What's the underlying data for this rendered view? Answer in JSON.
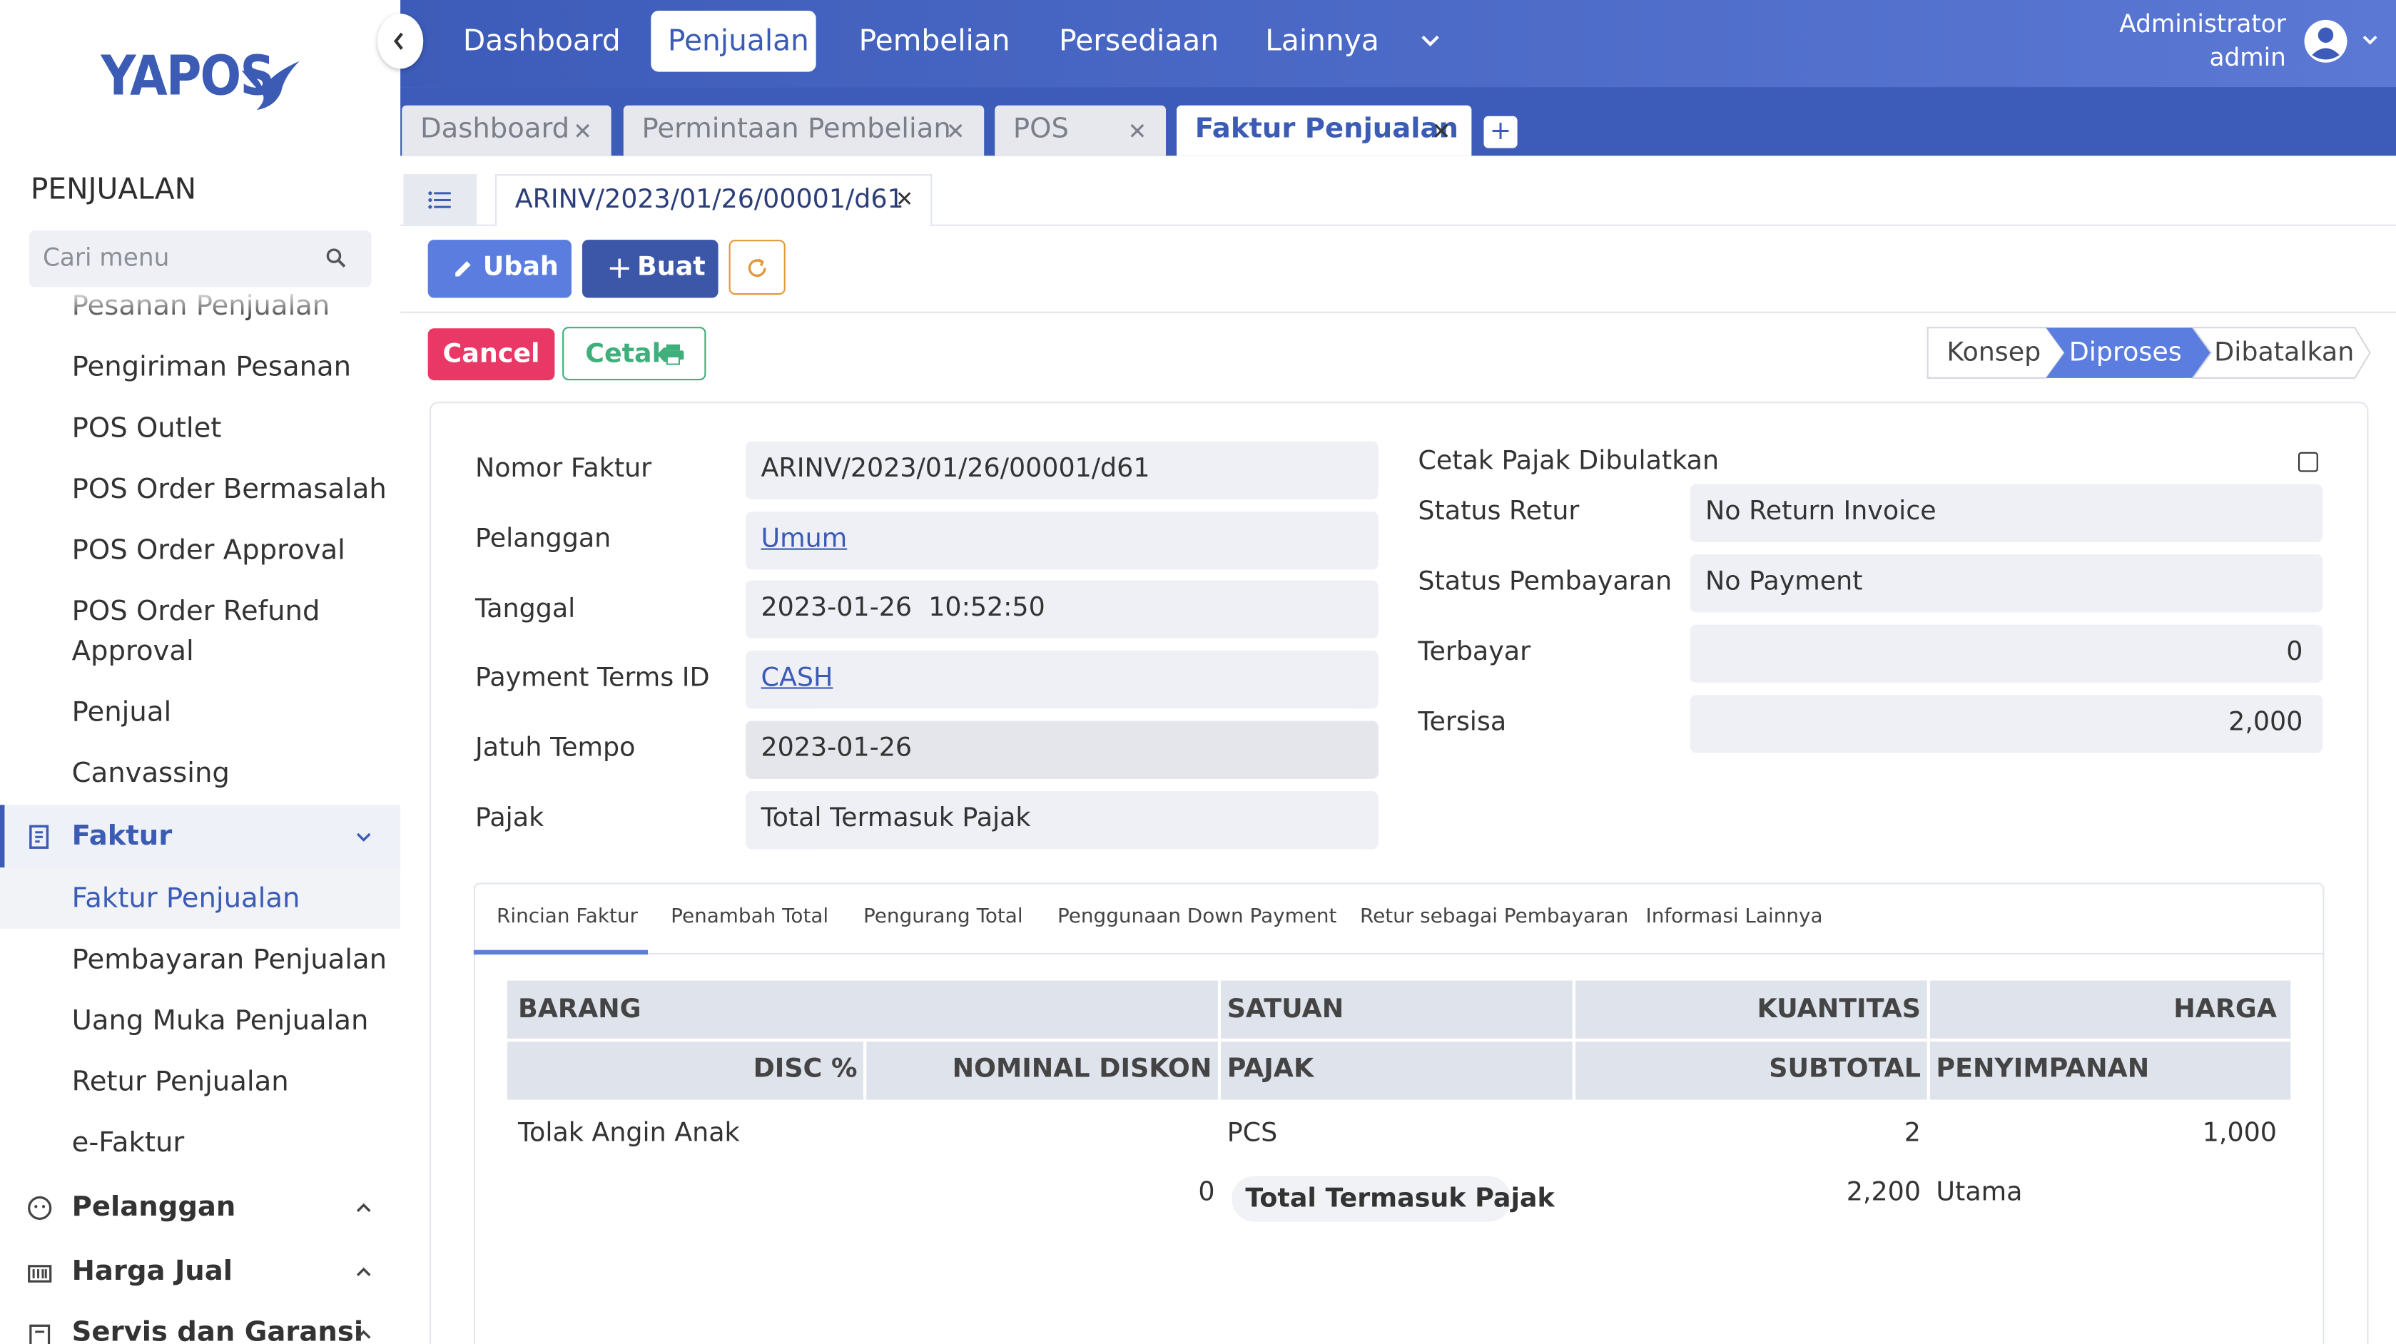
{
  "brand": {
    "logo_text": "YAPOS"
  },
  "sidebar": {
    "section_title": "PENJUALAN",
    "search_placeholder": "Cari menu",
    "items": [
      {
        "label": "Pesanan Penjualan"
      },
      {
        "label": "Pengiriman Pesanan"
      },
      {
        "label": "POS Outlet"
      },
      {
        "label": "POS Order Bermasalah"
      },
      {
        "label": "POS Order Approval"
      },
      {
        "label": "POS Order Refund"
      },
      {
        "label": "Approval"
      },
      {
        "label": "Penjual"
      },
      {
        "label": "Canvassing"
      }
    ],
    "faktur_group": {
      "label": "Faktur",
      "children": [
        "Faktur Penjualan",
        "Pembayaran Penjualan",
        "Uang Muka Penjualan",
        "Retur Penjualan",
        "e-Faktur"
      ]
    },
    "groups": [
      {
        "label": "Pelanggan"
      },
      {
        "label": "Harga Jual"
      },
      {
        "label": "Servis dan Garansi"
      }
    ]
  },
  "topnav": {
    "items": [
      "Dashboard",
      "Penjualan",
      "Pembelian",
      "Persediaan",
      "Lainnya"
    ],
    "active": "Penjualan",
    "user_name": "Administrator",
    "user_role": "admin"
  },
  "tabs": [
    {
      "label": "Dashboard"
    },
    {
      "label": "Permintaan Pembelian"
    },
    {
      "label": "POS"
    },
    {
      "label": "Faktur Penjualan",
      "active": true
    }
  ],
  "tab_plus": "+",
  "doc_tab": {
    "label": "ARINV/2023/01/26/00001/d61"
  },
  "actions": {
    "ubah": "Ubah",
    "buat": "Buat",
    "cancel": "Cancel",
    "cetak": "Cetak"
  },
  "status_steps": [
    "Konsep",
    "Diproses",
    "Dibatalkan"
  ],
  "status_active": "Diproses",
  "form_left": [
    {
      "label": "Nomor Faktur",
      "value": "ARINV/2023/01/26/00001/d61"
    },
    {
      "label": "Pelanggan",
      "value": "Umum"
    },
    {
      "label": "Tanggal",
      "value": "2023-01-26  10:52:50"
    },
    {
      "label": "Payment Terms ID",
      "value": "CASH"
    },
    {
      "label": "Jatuh Tempo",
      "value": "2023-01-26"
    },
    {
      "label": "Pajak",
      "value": "Total Termasuk Pajak"
    }
  ],
  "form_right": {
    "cetak_pajak_label": "Cetak Pajak Dibulatkan",
    "cetak_pajak_checked": false,
    "fields": [
      {
        "label": "Status Retur",
        "value": "No Return Invoice"
      },
      {
        "label": "Status Pembayaran",
        "value": "No Payment"
      },
      {
        "label": "Terbayar",
        "value": "0"
      },
      {
        "label": "Tersisa",
        "value": "2,000"
      }
    ]
  },
  "inner_tabs": [
    "Rincian Faktur",
    "Penambah Total",
    "Pengurang Total",
    "Penggunaan Down Payment",
    "Retur sebagai Pembayaran",
    "Informasi Lainnya"
  ],
  "table": {
    "header_row1": [
      "BARANG",
      "SATUAN",
      "KUANTITAS",
      "HARGA"
    ],
    "header_row2": [
      "DISC %",
      "NOMINAL DISKON",
      "PAJAK",
      "SUBTOTAL",
      "PENYIMPANAN"
    ],
    "row": {
      "barang": "Tolak Angin Anak",
      "satuan": "PCS",
      "kuantitas": "2",
      "harga": "1,000",
      "nominal_diskon": "0",
      "pajak": "Total Termasuk Pajak",
      "subtotal": "2,200",
      "penyimpanan": "Utama"
    }
  },
  "colors": {
    "primary": "#3b5bb5",
    "nav_gradient_start": "#3d5bb8",
    "nav_gradient_end": "#5a78d4",
    "cancel": "#e93865",
    "cetak": "#3fb07c",
    "step_active": "#5b7de0"
  }
}
